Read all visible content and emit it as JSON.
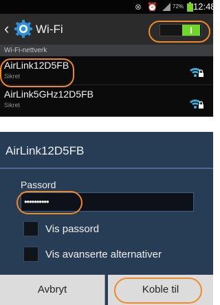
{
  "status_bar": {
    "time": "12:48",
    "battery_percent": "72%",
    "icons": [
      "alarm-icon",
      "clock-icon",
      "signal-icon",
      "battery-icon"
    ]
  },
  "settings": {
    "title": "Wi-Fi",
    "section_header": "Wi-Fi-nettverk",
    "wifi_enabled": true,
    "networks": [
      {
        "name": "AirLink12D5FB",
        "security": "Sikret"
      },
      {
        "name": "AirLink5GHz12D5FB",
        "security": "Sikret"
      }
    ]
  },
  "dialog": {
    "title": "AirLink12D5FB",
    "password_label": "Passord",
    "password_value": "••••••••••",
    "show_password_label": "Vis passord",
    "advanced_label": "Vis avanserte alternativer",
    "cancel_label": "Avbryt",
    "connect_label": "Koble til"
  },
  "colors": {
    "highlight": "#f08a28",
    "toggle_on": "#6ed72a",
    "dialog_bg": "#273d55",
    "wifi_icon": "#3db4e0"
  }
}
